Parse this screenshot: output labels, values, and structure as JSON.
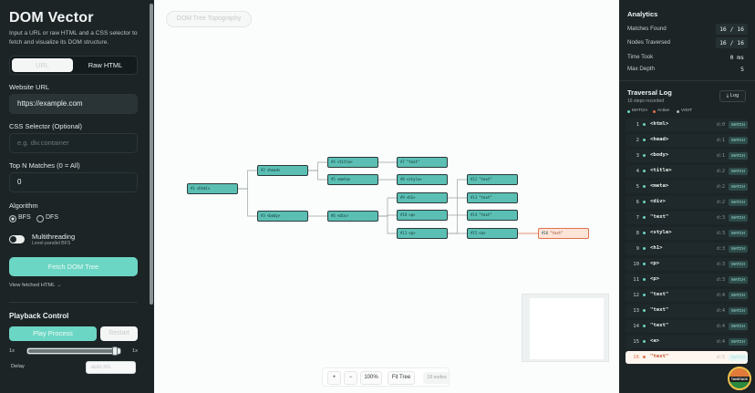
{
  "app": {
    "title": "DOM Vector",
    "subtitle": "Input a URL or raw HTML and a CSS selector to fetch and visualize its DOM structure."
  },
  "source_toggle": {
    "url": "URL",
    "raw": "Raw HTML",
    "selected": "URL"
  },
  "form": {
    "website_url_label": "Website URL",
    "website_url_value": "https://example.com",
    "css_selector_label": "CSS Selector (Optional)",
    "css_selector_placeholder": "e.g. div.container",
    "top_n_label": "Top N Matches (0 = All)",
    "top_n_value": "0",
    "algorithm_label": "Algorithm",
    "algorithm_options": [
      "BFS",
      "DFS"
    ],
    "algorithm_selected": "BFS",
    "multithreading_label": "Multithreading",
    "multithreading_sub": "Level-parallel BFS",
    "fetch_button": "Fetch DOM Tree",
    "view_html_link": "View fetched HTML →"
  },
  "playback": {
    "title": "Playback Control",
    "play_button": "Play Process",
    "restart_button": "Restart",
    "speed_min": "1x",
    "speed_max": "1x",
    "speed_fraction": 0.97,
    "delay_label": "Delay",
    "delay_placeholder": "auto ms"
  },
  "canvas": {
    "chip": "DOM Tree Topography",
    "zoom_minus": "−",
    "zoom_plus": "+",
    "zoom_level": "100%",
    "fit_button": "Fit Tree",
    "node_count": "18 nodes"
  },
  "tree": {
    "nodes": [
      {
        "id": "#1",
        "label": "<html>",
        "state": "normal"
      },
      {
        "id": "#2",
        "label": "<head>",
        "state": "normal"
      },
      {
        "id": "#3",
        "label": "<body>",
        "state": "normal"
      },
      {
        "id": "#4",
        "label": "<title>",
        "state": "normal"
      },
      {
        "id": "#5",
        "label": "<meta>",
        "state": "normal"
      },
      {
        "id": "#6",
        "label": "<div>",
        "state": "normal"
      },
      {
        "id": "#7",
        "label": "\"text\"",
        "state": "normal"
      },
      {
        "id": "#8",
        "label": "<style>",
        "state": "normal"
      },
      {
        "id": "#9",
        "label": "<h1>",
        "state": "normal"
      },
      {
        "id": "#10",
        "label": "<p>",
        "state": "normal"
      },
      {
        "id": "#11",
        "label": "<p>",
        "state": "normal"
      },
      {
        "id": "#12",
        "label": "\"text\"",
        "state": "normal"
      },
      {
        "id": "#13",
        "label": "\"text\"",
        "state": "normal"
      },
      {
        "id": "#14",
        "label": "\"text\"",
        "state": "normal"
      },
      {
        "id": "#15",
        "label": "<a>",
        "state": "normal"
      },
      {
        "id": "#16",
        "label": "\"text\"",
        "state": "active"
      }
    ]
  },
  "analytics": {
    "title": "Analytics",
    "rows": [
      {
        "label": "Matches Found",
        "value": "16 / 16"
      },
      {
        "label": "Nodes Traversed",
        "value": "16 / 16"
      },
      {
        "label": "Time Took",
        "value": "0 ms"
      },
      {
        "label": "Max Depth",
        "value": "5"
      }
    ]
  },
  "traversal_log": {
    "title": "Traversal Log",
    "subtitle": "16 steps recorded",
    "log_button": "Log",
    "legend": [
      "MATCH",
      "Active",
      "VISIT"
    ],
    "entries": [
      {
        "n": "1",
        "tag": "<html>",
        "depth": "d:0",
        "badge": "MATCH"
      },
      {
        "n": "2",
        "tag": "<head>",
        "depth": "d:1",
        "badge": "MATCH"
      },
      {
        "n": "3",
        "tag": "<body>",
        "depth": "d:1",
        "badge": "MATCH"
      },
      {
        "n": "4",
        "tag": "<title>",
        "depth": "d:2",
        "badge": "MATCH"
      },
      {
        "n": "5",
        "tag": "<meta>",
        "depth": "d:2",
        "badge": "MATCH"
      },
      {
        "n": "6",
        "tag": "<div>",
        "depth": "d:2",
        "badge": "MATCH"
      },
      {
        "n": "7",
        "tag": "\"text\"",
        "depth": "d:3",
        "badge": "MATCH"
      },
      {
        "n": "8",
        "tag": "<style>",
        "depth": "d:3",
        "badge": "MATCH"
      },
      {
        "n": "9",
        "tag": "<h1>",
        "depth": "d:3",
        "badge": "MATCH"
      },
      {
        "n": "10",
        "tag": "<p>",
        "depth": "d:3",
        "badge": "MATCH"
      },
      {
        "n": "11",
        "tag": "<p>",
        "depth": "d:3",
        "badge": "MATCH"
      },
      {
        "n": "12",
        "tag": "\"text\"",
        "depth": "d:4",
        "badge": "MATCH"
      },
      {
        "n": "13",
        "tag": "\"text\"",
        "depth": "d:4",
        "badge": "MATCH"
      },
      {
        "n": "14",
        "tag": "\"text\"",
        "depth": "d:4",
        "badge": "MATCH"
      },
      {
        "n": "15",
        "tag": "<a>",
        "depth": "d:4",
        "badge": "MATCH"
      },
      {
        "n": "16",
        "tag": "\"text\"",
        "depth": "d:5",
        "badge": "MATCH",
        "active": true
      }
    ]
  },
  "logo_text": "TANSTACK",
  "colors": {
    "accent": "#6cd6c4",
    "active": "#e0724d",
    "panel": "#1c2426",
    "node": "#5bbfb4"
  }
}
